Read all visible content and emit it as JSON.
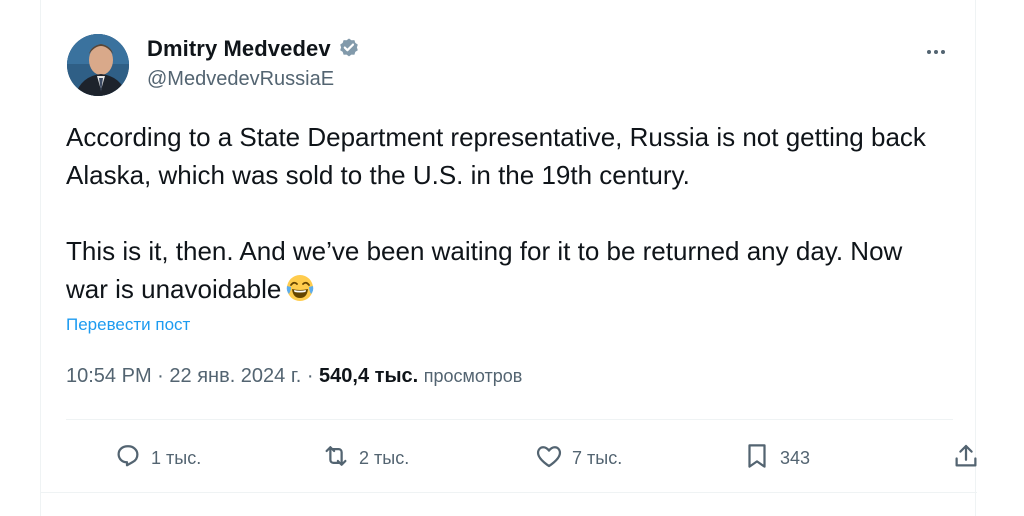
{
  "author": {
    "name": "Dmitry Medvedev",
    "handle": "@MedvedevRussiaE"
  },
  "tweet": {
    "paragraph1": "According to a State Department representative, Russia is not getting back Alaska, which was sold to the U.S. in the 19th century.",
    "paragraph2": "This is it, then. And we’ve been waiting for it to be returned any day. Now war is unavoidable",
    "translate_link": "Перевести пост"
  },
  "meta": {
    "time": "10:54 PM",
    "separator1": " · ",
    "date": "22 янв. 2024 г.",
    "separator2": " · ",
    "views_count": "540,4 тыс.",
    "views_label": "просмотров"
  },
  "actions": {
    "replies": "1 тыс.",
    "reposts": "2 тыс.",
    "likes": "7 тыс.",
    "bookmarks": "343"
  },
  "colors": {
    "link": "#1d9bf0",
    "muted": "#536471",
    "text": "#0f1419",
    "border": "#eff3f4"
  },
  "icons": [
    "more-options-icon",
    "verified-badge-icon",
    "laughing-emoji-icon",
    "reply-icon",
    "repost-icon",
    "like-icon",
    "bookmark-icon",
    "share-icon"
  ]
}
